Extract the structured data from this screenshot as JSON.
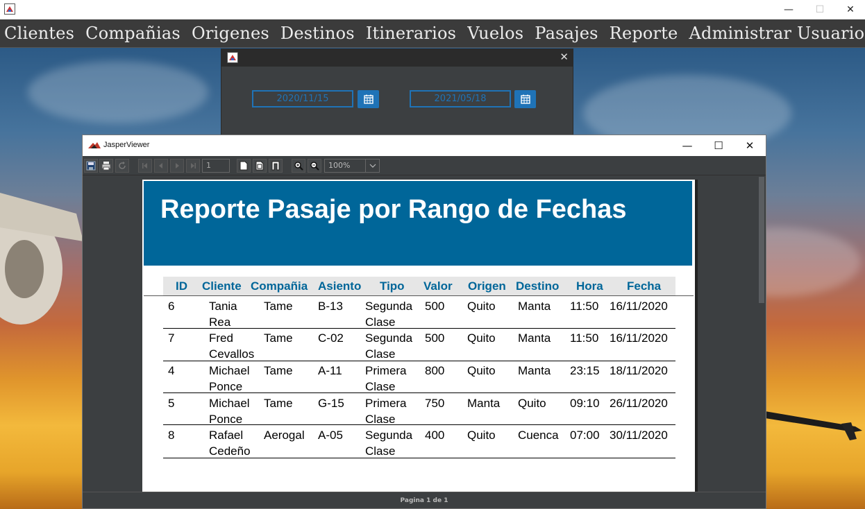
{
  "window": {
    "minimize": "—",
    "maximize": "☐",
    "close": "✕"
  },
  "menu": [
    "Clientes",
    "Compañias",
    "Origenes",
    "Destinos",
    "Itinerarios",
    "Vuelos",
    "Pasajes",
    "Reporte",
    "Administrar Usuarios"
  ],
  "dialog": {
    "close": "✕",
    "date_from": "2020/11/15",
    "date_to": "2021/05/18"
  },
  "viewer": {
    "title": "JasperViewer",
    "minimize": "—",
    "maximize": "☐",
    "close": "✕",
    "page_number": "1",
    "zoom": "100%",
    "status": "Pagina 1 de 1"
  },
  "report": {
    "title": "Reporte Pasaje por Rango de Fechas",
    "columns": [
      "ID",
      "Cliente",
      "Compañia",
      "Asiento",
      "Tipo",
      "Valor",
      "Origen",
      "Destino",
      "Hora",
      "Fecha"
    ],
    "rows": [
      [
        "6",
        "Tania\nRea",
        "Tame",
        "B-13",
        "Segunda\nClase",
        "500",
        "Quito",
        "Manta",
        "11:50",
        "16/11/2020"
      ],
      [
        "7",
        "Fred\nCevallos",
        "Tame",
        "C-02",
        "Segunda\nClase",
        "500",
        "Quito",
        "Manta",
        "11:50",
        "16/11/2020"
      ],
      [
        "4",
        "Michael\nPonce",
        "Tame",
        "A-11",
        "Primera\nClase",
        "800",
        "Quito",
        "Manta",
        "23:15",
        "18/11/2020"
      ],
      [
        "5",
        "Michael\nPonce",
        "Tame",
        "G-15",
        "Primera\nClase",
        "750",
        "Manta",
        "Quito",
        "09:10",
        "26/11/2020"
      ],
      [
        "8",
        "Rafael\nCedeño",
        "Aerogal",
        "A-05",
        "Segunda\nClase",
        "400",
        "Quito",
        "Cuenca",
        "07:00",
        "30/11/2020"
      ]
    ]
  }
}
